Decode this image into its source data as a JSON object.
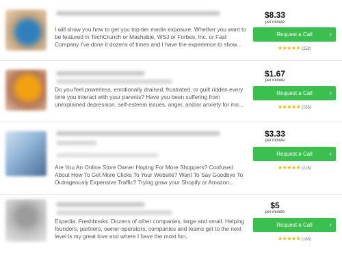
{
  "listings": [
    {
      "description": "I will show you how to get you top-tier media exposure. Whether you want to be featured in TechCrunch or Mashable, WSJ or Forbes, Inc. or Fast Company I've done it dozens of times and I have the experience to show...",
      "price": "$8.33",
      "per": "per minute",
      "button": "Request a Call",
      "stars": "★★★★★",
      "reviews": "(252)",
      "thumb_colors": [
        "#c9a77c",
        "#2f7fbf"
      ]
    },
    {
      "description": "Do you feel powerless, emotionally drained, frustrated, or guilt ridden every time you interact with your parents? Have you been suffering from unexplained depression, self-esteem issues, anger, and/or anxiety for mo...",
      "price": "$1.67",
      "per": "per minute",
      "button": "Request a Call",
      "stars": "★★★★★",
      "reviews": "(163)",
      "thumb_colors": [
        "#b67a5a",
        "#f3a20f"
      ]
    },
    {
      "description": "Are You An Online Store Owner Hoping For More Shoppers? Confused About How To Get More Clicks To Your Website? Want To Say Goodbye To Outrageously Expensive Traffic? Trying grow your Shopify or Amazon...",
      "price": "$3.33",
      "per": "per minute",
      "button": "Request a Call",
      "stars": "★★★★★",
      "reviews": "(215)",
      "thumb_colors": [
        "#8fb3d6",
        "#4a6f95"
      ]
    },
    {
      "description": "Expedia. Freshbooks. Dozens of other companies, large and small. Helping founders, partners, owner-operators, companies and teams get to the next level is my great love and where I have the most fun.",
      "price": "$5",
      "per": "per minute",
      "button": "Request a Call",
      "stars": "★★★★★",
      "reviews": "(183)",
      "thumb_colors": [
        "#d2d2d2",
        "#9c9c9c"
      ]
    }
  ],
  "colors": {
    "button": "#3bbf4f",
    "star": "#f5b400"
  }
}
